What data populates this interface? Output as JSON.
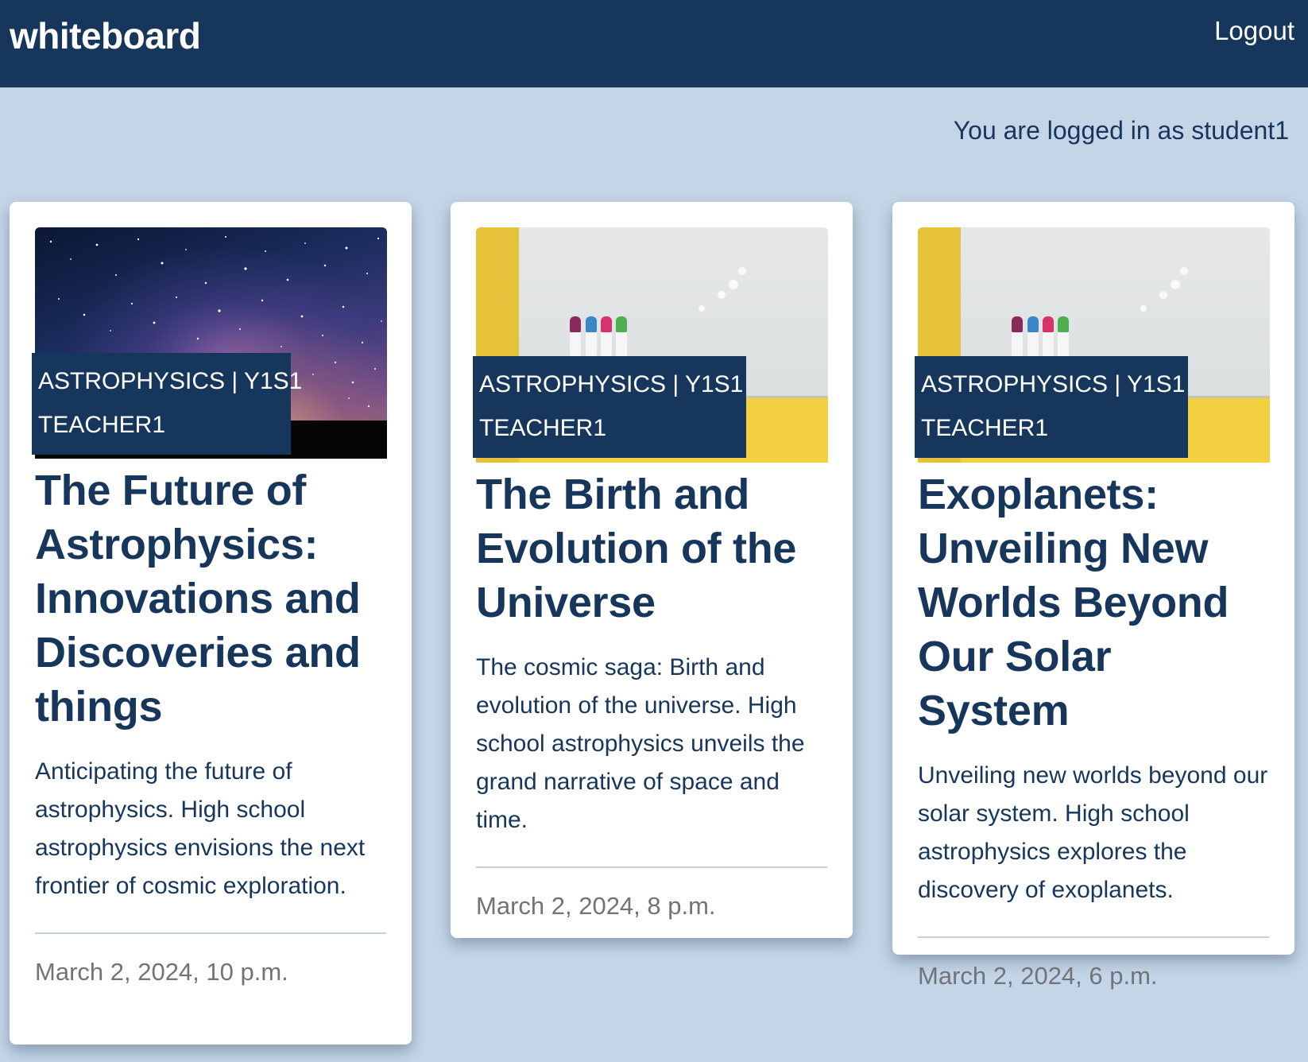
{
  "header": {
    "brand": "whiteboard",
    "logout_label": "Logout"
  },
  "status": {
    "logged_in_text": "You are logged in as student1"
  },
  "cards": [
    {
      "image": "night-sky-milky-way",
      "tag_line1": "ASTROPHYSICS | Y1S1",
      "tag_line2": "TEACHER1",
      "title": "The Future of Astrophysics: Innovations and Discoveries and things",
      "description": "Anticipating the future of astrophysics. High school astrophysics envisions the next frontier of cosmic exploration.",
      "date": "March 2, 2024, 10 p.m."
    },
    {
      "image": "whiteboard-markers",
      "tag_line1": "ASTROPHYSICS | Y1S1",
      "tag_line2": "TEACHER1",
      "title": "The Birth and Evolution of the Universe",
      "description": "The cosmic saga: Birth and evolution of the universe. High school astrophysics unveils the grand narrative of space and time.",
      "date": "March 2, 2024, 8 p.m."
    },
    {
      "image": "whiteboard-markers",
      "tag_line1": "ASTROPHYSICS | Y1S1",
      "tag_line2": "TEACHER1",
      "title": "Exoplanets: Unveiling New Worlds Beyond Our Solar System",
      "description": "Unveiling new worlds beyond our solar system. High school astrophysics explores the discovery of exoplanets.",
      "date": "March 2, 2024, 6 p.m."
    }
  ],
  "colors": {
    "navbar": "#17365b",
    "page_background": "#c4d5e7",
    "card_background": "#ffffff",
    "date_text": "#6f747a"
  }
}
